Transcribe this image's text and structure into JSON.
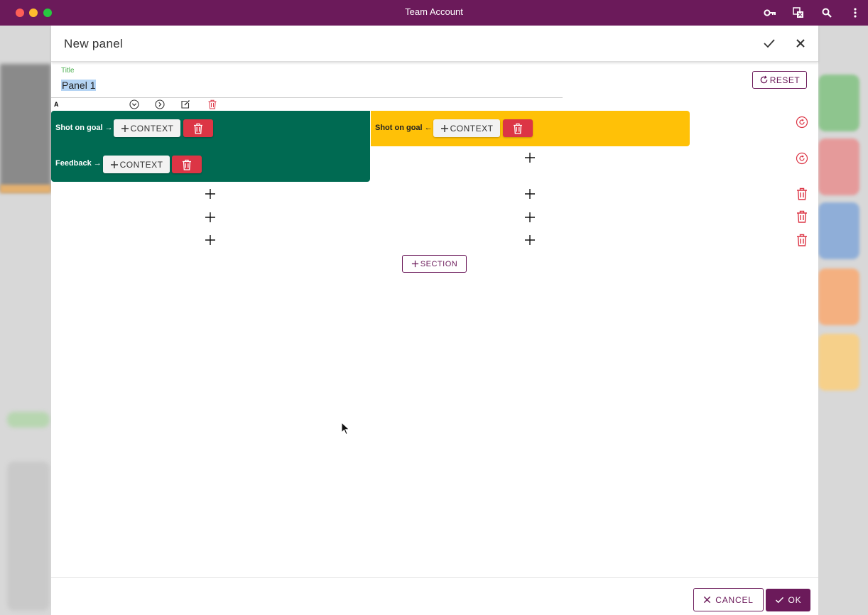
{
  "window": {
    "title": "Team Account"
  },
  "dialog": {
    "title": "New panel",
    "title_field": {
      "label": "Title",
      "value": "Panel 1"
    },
    "reset_label": "RESET",
    "section": {
      "letter": "A",
      "rows": [
        {
          "label": "Shot on goal →",
          "context_label": "CONTEXT"
        },
        {
          "label": "Feedback →",
          "context_label": "CONTEXT"
        }
      ],
      "opponent_row": {
        "label": "Shot on goal ←",
        "context_label": "CONTEXT"
      }
    },
    "add_section_label": "SECTION",
    "cancel_label": "CANCEL",
    "ok_label": "OK"
  },
  "colors": {
    "brand": "#6b1a5a",
    "team_row": "#006a52",
    "opponent_row": "#ffc107",
    "danger": "#dc3545",
    "title_label": "#4caf50"
  }
}
